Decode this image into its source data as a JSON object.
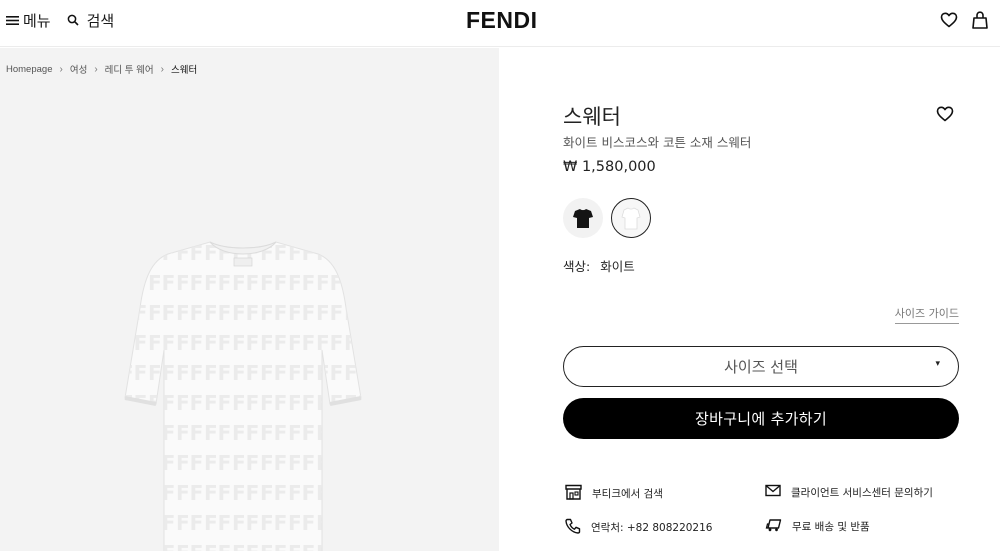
{
  "header": {
    "menu_label": "메뉴",
    "search_label": "검색",
    "logo": "FENDI"
  },
  "breadcrumb": [
    "Homepage",
    "여성",
    "레디 투 웨어",
    "스웨터"
  ],
  "product": {
    "title": "스웨터",
    "subtitle": "화이트 비스코스와 코튼 소재 스웨터",
    "price": "₩ 1,580,000",
    "color_label": "색상:",
    "color_value": "화이트",
    "swatches": [
      {
        "name": "black",
        "color": "#111111"
      },
      {
        "name": "white",
        "color": "#ffffff",
        "selected": true
      }
    ]
  },
  "actions": {
    "size_guide": "사이즈 가이드",
    "size_select": "사이즈 선택",
    "add_to_cart": "장바구니에 추가하기"
  },
  "services": {
    "boutique": "부티크에서 검색",
    "client_service": "클라이언트 서비스센터 문의하기",
    "contact": "연락처: +82 808220216",
    "shipping": "무료 배송 및 반품"
  },
  "colors": {
    "accent": "#000000",
    "image_bg": "#f3f3f3"
  }
}
